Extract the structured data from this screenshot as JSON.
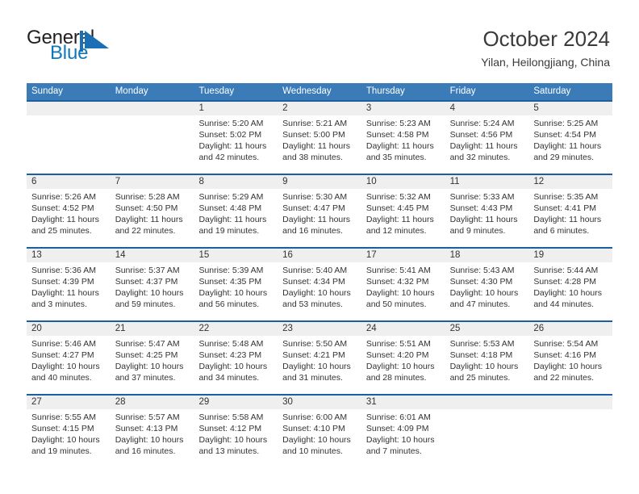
{
  "brand": {
    "word1": "General",
    "word2": "Blue",
    "logo_icon": "flag-triangle-icon",
    "accent_color": "#1077bd"
  },
  "header": {
    "title": "October 2024",
    "subtitle": "Yilan, Heilongjiang, China"
  },
  "theme": {
    "header_blue": "#3b7cb8",
    "divider_blue": "#1c5fa0",
    "daynum_band": "#efefef"
  },
  "calendar": {
    "day_headers": [
      "Sunday",
      "Monday",
      "Tuesday",
      "Wednesday",
      "Thursday",
      "Friday",
      "Saturday"
    ],
    "labels": {
      "sunrise": "Sunrise:",
      "sunset": "Sunset:",
      "daylight": "Daylight:"
    },
    "weeks": [
      [
        {
          "day": "",
          "sunrise": "",
          "sunset": "",
          "daylight_line1": "",
          "daylight_line2": ""
        },
        {
          "day": "",
          "sunrise": "",
          "sunset": "",
          "daylight_line1": "",
          "daylight_line2": ""
        },
        {
          "day": "1",
          "sunrise": "Sunrise: 5:20 AM",
          "sunset": "Sunset: 5:02 PM",
          "daylight_line1": "Daylight: 11 hours",
          "daylight_line2": "and 42 minutes."
        },
        {
          "day": "2",
          "sunrise": "Sunrise: 5:21 AM",
          "sunset": "Sunset: 5:00 PM",
          "daylight_line1": "Daylight: 11 hours",
          "daylight_line2": "and 38 minutes."
        },
        {
          "day": "3",
          "sunrise": "Sunrise: 5:23 AM",
          "sunset": "Sunset: 4:58 PM",
          "daylight_line1": "Daylight: 11 hours",
          "daylight_line2": "and 35 minutes."
        },
        {
          "day": "4",
          "sunrise": "Sunrise: 5:24 AM",
          "sunset": "Sunset: 4:56 PM",
          "daylight_line1": "Daylight: 11 hours",
          "daylight_line2": "and 32 minutes."
        },
        {
          "day": "5",
          "sunrise": "Sunrise: 5:25 AM",
          "sunset": "Sunset: 4:54 PM",
          "daylight_line1": "Daylight: 11 hours",
          "daylight_line2": "and 29 minutes."
        }
      ],
      [
        {
          "day": "6",
          "sunrise": "Sunrise: 5:26 AM",
          "sunset": "Sunset: 4:52 PM",
          "daylight_line1": "Daylight: 11 hours",
          "daylight_line2": "and 25 minutes."
        },
        {
          "day": "7",
          "sunrise": "Sunrise: 5:28 AM",
          "sunset": "Sunset: 4:50 PM",
          "daylight_line1": "Daylight: 11 hours",
          "daylight_line2": "and 22 minutes."
        },
        {
          "day": "8",
          "sunrise": "Sunrise: 5:29 AM",
          "sunset": "Sunset: 4:48 PM",
          "daylight_line1": "Daylight: 11 hours",
          "daylight_line2": "and 19 minutes."
        },
        {
          "day": "9",
          "sunrise": "Sunrise: 5:30 AM",
          "sunset": "Sunset: 4:47 PM",
          "daylight_line1": "Daylight: 11 hours",
          "daylight_line2": "and 16 minutes."
        },
        {
          "day": "10",
          "sunrise": "Sunrise: 5:32 AM",
          "sunset": "Sunset: 4:45 PM",
          "daylight_line1": "Daylight: 11 hours",
          "daylight_line2": "and 12 minutes."
        },
        {
          "day": "11",
          "sunrise": "Sunrise: 5:33 AM",
          "sunset": "Sunset: 4:43 PM",
          "daylight_line1": "Daylight: 11 hours",
          "daylight_line2": "and 9 minutes."
        },
        {
          "day": "12",
          "sunrise": "Sunrise: 5:35 AM",
          "sunset": "Sunset: 4:41 PM",
          "daylight_line1": "Daylight: 11 hours",
          "daylight_line2": "and 6 minutes."
        }
      ],
      [
        {
          "day": "13",
          "sunrise": "Sunrise: 5:36 AM",
          "sunset": "Sunset: 4:39 PM",
          "daylight_line1": "Daylight: 11 hours",
          "daylight_line2": "and 3 minutes."
        },
        {
          "day": "14",
          "sunrise": "Sunrise: 5:37 AM",
          "sunset": "Sunset: 4:37 PM",
          "daylight_line1": "Daylight: 10 hours",
          "daylight_line2": "and 59 minutes."
        },
        {
          "day": "15",
          "sunrise": "Sunrise: 5:39 AM",
          "sunset": "Sunset: 4:35 PM",
          "daylight_line1": "Daylight: 10 hours",
          "daylight_line2": "and 56 minutes."
        },
        {
          "day": "16",
          "sunrise": "Sunrise: 5:40 AM",
          "sunset": "Sunset: 4:34 PM",
          "daylight_line1": "Daylight: 10 hours",
          "daylight_line2": "and 53 minutes."
        },
        {
          "day": "17",
          "sunrise": "Sunrise: 5:41 AM",
          "sunset": "Sunset: 4:32 PM",
          "daylight_line1": "Daylight: 10 hours",
          "daylight_line2": "and 50 minutes."
        },
        {
          "day": "18",
          "sunrise": "Sunrise: 5:43 AM",
          "sunset": "Sunset: 4:30 PM",
          "daylight_line1": "Daylight: 10 hours",
          "daylight_line2": "and 47 minutes."
        },
        {
          "day": "19",
          "sunrise": "Sunrise: 5:44 AM",
          "sunset": "Sunset: 4:28 PM",
          "daylight_line1": "Daylight: 10 hours",
          "daylight_line2": "and 44 minutes."
        }
      ],
      [
        {
          "day": "20",
          "sunrise": "Sunrise: 5:46 AM",
          "sunset": "Sunset: 4:27 PM",
          "daylight_line1": "Daylight: 10 hours",
          "daylight_line2": "and 40 minutes."
        },
        {
          "day": "21",
          "sunrise": "Sunrise: 5:47 AM",
          "sunset": "Sunset: 4:25 PM",
          "daylight_line1": "Daylight: 10 hours",
          "daylight_line2": "and 37 minutes."
        },
        {
          "day": "22",
          "sunrise": "Sunrise: 5:48 AM",
          "sunset": "Sunset: 4:23 PM",
          "daylight_line1": "Daylight: 10 hours",
          "daylight_line2": "and 34 minutes."
        },
        {
          "day": "23",
          "sunrise": "Sunrise: 5:50 AM",
          "sunset": "Sunset: 4:21 PM",
          "daylight_line1": "Daylight: 10 hours",
          "daylight_line2": "and 31 minutes."
        },
        {
          "day": "24",
          "sunrise": "Sunrise: 5:51 AM",
          "sunset": "Sunset: 4:20 PM",
          "daylight_line1": "Daylight: 10 hours",
          "daylight_line2": "and 28 minutes."
        },
        {
          "day": "25",
          "sunrise": "Sunrise: 5:53 AM",
          "sunset": "Sunset: 4:18 PM",
          "daylight_line1": "Daylight: 10 hours",
          "daylight_line2": "and 25 minutes."
        },
        {
          "day": "26",
          "sunrise": "Sunrise: 5:54 AM",
          "sunset": "Sunset: 4:16 PM",
          "daylight_line1": "Daylight: 10 hours",
          "daylight_line2": "and 22 minutes."
        }
      ],
      [
        {
          "day": "27",
          "sunrise": "Sunrise: 5:55 AM",
          "sunset": "Sunset: 4:15 PM",
          "daylight_line1": "Daylight: 10 hours",
          "daylight_line2": "and 19 minutes."
        },
        {
          "day": "28",
          "sunrise": "Sunrise: 5:57 AM",
          "sunset": "Sunset: 4:13 PM",
          "daylight_line1": "Daylight: 10 hours",
          "daylight_line2": "and 16 minutes."
        },
        {
          "day": "29",
          "sunrise": "Sunrise: 5:58 AM",
          "sunset": "Sunset: 4:12 PM",
          "daylight_line1": "Daylight: 10 hours",
          "daylight_line2": "and 13 minutes."
        },
        {
          "day": "30",
          "sunrise": "Sunrise: 6:00 AM",
          "sunset": "Sunset: 4:10 PM",
          "daylight_line1": "Daylight: 10 hours",
          "daylight_line2": "and 10 minutes."
        },
        {
          "day": "31",
          "sunrise": "Sunrise: 6:01 AM",
          "sunset": "Sunset: 4:09 PM",
          "daylight_line1": "Daylight: 10 hours",
          "daylight_line2": "and 7 minutes."
        },
        {
          "day": "",
          "sunrise": "",
          "sunset": "",
          "daylight_line1": "",
          "daylight_line2": ""
        },
        {
          "day": "",
          "sunrise": "",
          "sunset": "",
          "daylight_line1": "",
          "daylight_line2": ""
        }
      ]
    ]
  }
}
